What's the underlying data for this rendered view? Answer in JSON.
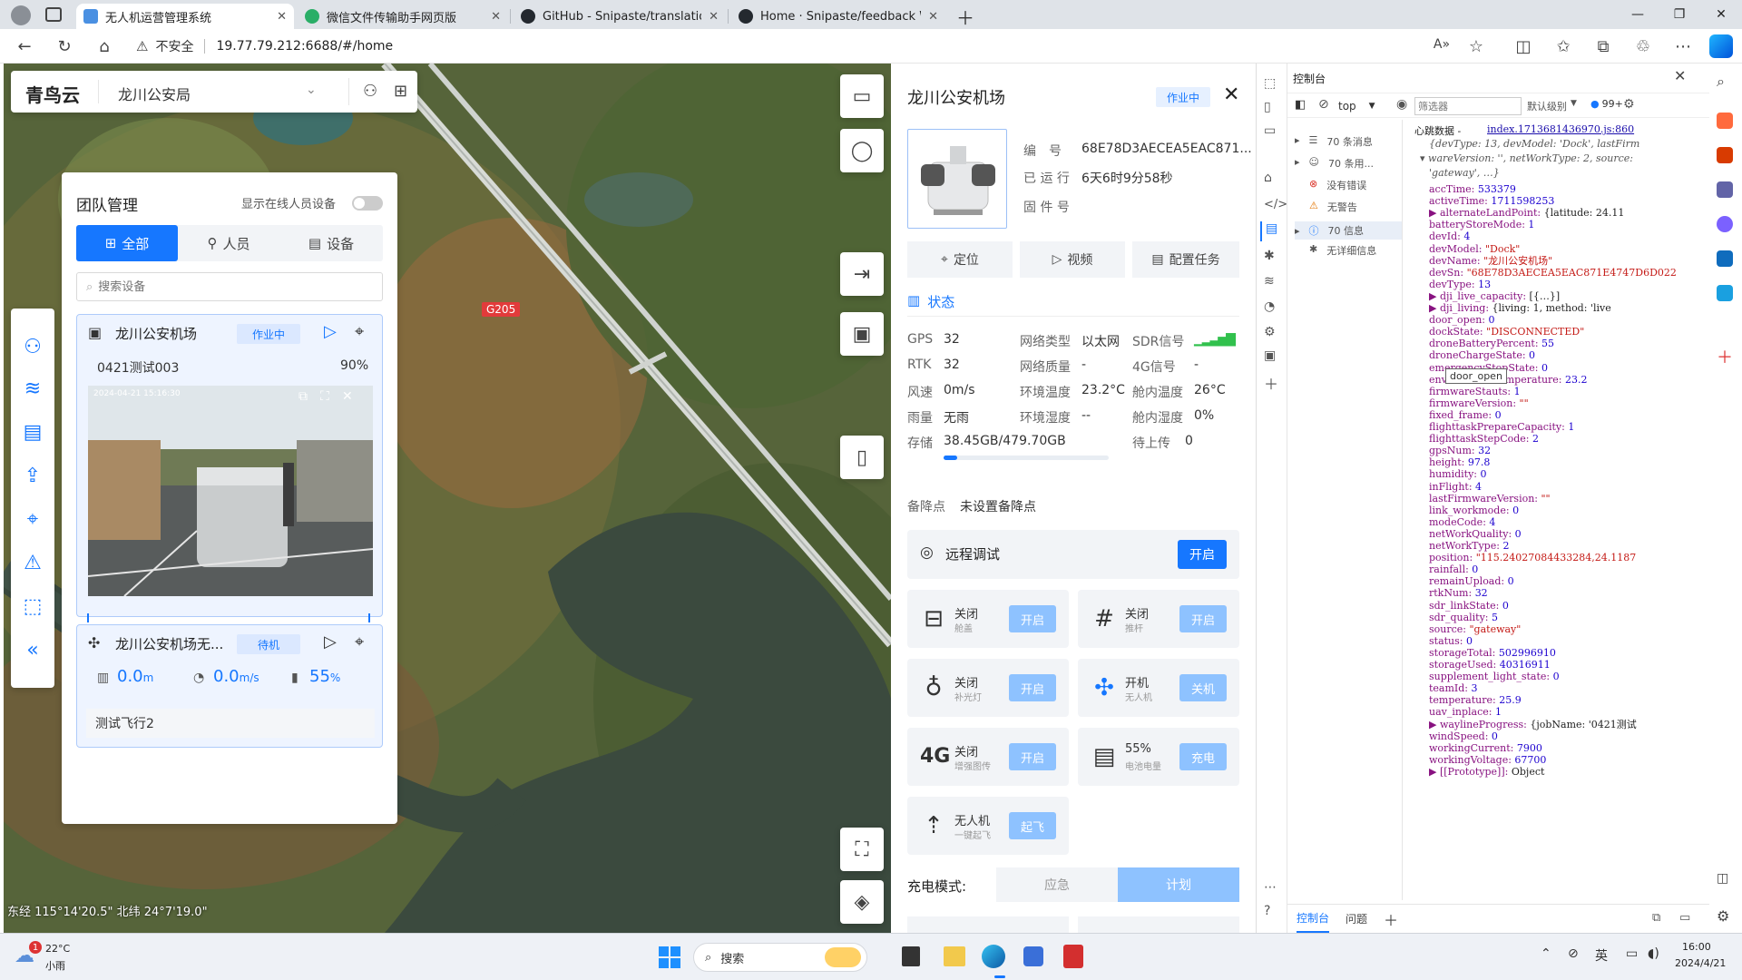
{
  "browser": {
    "tabs": [
      {
        "label": "无人机运营管理系统",
        "active": true
      },
      {
        "label": "微信文件传输助手网页版"
      },
      {
        "label": "GitHub - Snipaste/translations: Tr"
      },
      {
        "label": "Home · Snipaste/feedback Wiki ·"
      }
    ],
    "security": "不安全",
    "url": "19.77.79.212:6688/#/home"
  },
  "app": {
    "logo": "青鸟云",
    "org": "龙川公安局"
  },
  "team": {
    "title": "团队管理",
    "show_online_label": "显示在线人员设备",
    "tabs": [
      "全部",
      "人员",
      "设备"
    ],
    "search_placeholder": "搜索设备",
    "dock_card": {
      "name": "龙川公安机场",
      "status": "作业中",
      "task": "0421测试003",
      "progress": "90%",
      "video_timestamp": "2024-04-21 15:16:30"
    },
    "drone_card": {
      "name": "龙川公安机场无...",
      "status": "待机",
      "height_value": "0.0",
      "height_unit": "m",
      "speed_value": "0.0",
      "speed_unit": "m/s",
      "battery_value": "55",
      "battery_unit": "%",
      "task": "测试飞行2"
    }
  },
  "map": {
    "road_label": "G205",
    "coords": "东经 115°14'20.5\" 北纬 24°7'19.0\""
  },
  "detail": {
    "title": "龙川公安机场",
    "status": "作业中",
    "id_label": "编　号",
    "id_value": "68E78D3AECEA5EAC871...",
    "run_label": "已 运 行",
    "run_value": "6天6时9分58秒",
    "fw_label": "固 件 号",
    "actions": [
      "定位",
      "视频",
      "配置任务"
    ],
    "state_title": "状态",
    "stats": [
      {
        "label": "GPS",
        "value": "32"
      },
      {
        "label": "网络类型",
        "value": "以太网"
      },
      {
        "label": "SDR信号",
        "value": ""
      },
      {
        "label": "RTK",
        "value": "32"
      },
      {
        "label": "网络质量",
        "value": "-"
      },
      {
        "label": "4G信号",
        "value": "-"
      },
      {
        "label": "风速",
        "value": "0m/s"
      },
      {
        "label": "环境温度",
        "value": "23.2°C"
      },
      {
        "label": "舱内温度",
        "value": "26°C"
      },
      {
        "label": "雨量",
        "value": "无雨"
      },
      {
        "label": "环境湿度",
        "value": "--"
      },
      {
        "label": "舱内湿度",
        "value": "0%"
      }
    ],
    "storage_label": "存储",
    "storage_value": "38.45GB/479.70GB",
    "storage_fraction": 0.08,
    "upload_label": "待上传",
    "upload_value": "0",
    "backup_label": "备降点",
    "backup_value": "未设置备降点",
    "remote_debug": "远程调试",
    "remote_debug_btn": "开启",
    "controls": [
      {
        "t1": "关闭",
        "t2": "舱盖",
        "btn": "开启",
        "icon": "hatch-icon"
      },
      {
        "t1": "关闭",
        "t2": "推杆",
        "btn": "开启",
        "icon": "pushrod-icon"
      },
      {
        "t1": "关闭",
        "t2": "补光灯",
        "btn": "开启",
        "icon": "lightbulb-icon"
      },
      {
        "t1": "开机",
        "t2": "无人机",
        "btn": "关机",
        "icon": "drone-icon"
      },
      {
        "t1": "关闭",
        "t2": "增强图传",
        "btn": "开启",
        "icon": "4g-icon"
      },
      {
        "t1": "55%",
        "t2": "电池电量",
        "btn": "充电",
        "icon": "battery-icon"
      },
      {
        "t1": "无人机",
        "t2": "一键起飞",
        "btn": "起飞",
        "icon": "takeoff-icon"
      }
    ],
    "charge_label": "充电模式:",
    "charge_modes": [
      "应急",
      "计划"
    ]
  },
  "devtools": {
    "title": "控制台",
    "context": "top",
    "filter_placeholder": "筛选器",
    "level": "默认级别",
    "issues": "99+",
    "sidebar": [
      {
        "label": "70 条消息"
      },
      {
        "label": "70 条用..."
      },
      {
        "label": "没有错误"
      },
      {
        "label": "无警告"
      },
      {
        "label": "70 信息"
      },
      {
        "label": "无详细信息"
      }
    ],
    "log_title": "心跳数据 -",
    "log_link": "index.1713681436970.js:860",
    "summary1": "{devType: 13, devModel: 'Dock', lastFirm",
    "summary2": "wareVersion: '', netWorkType: 2, source:",
    "summary3": "'gateway', …}",
    "tooltip": "door_open",
    "lines": [
      {
        "k": "accTime",
        "v": "533379",
        "c": "n"
      },
      {
        "k": "activeTime",
        "v": "1711598253",
        "c": "n"
      },
      {
        "k": "▶ alternateLandPoint",
        "v": "{latitude: 24.11",
        "c": "p"
      },
      {
        "k": "batteryStoreMode",
        "v": "1",
        "c": "n"
      },
      {
        "k": "devId",
        "v": "4",
        "c": "n"
      },
      {
        "k": "devModel",
        "v": "\"Dock\"",
        "c": "s"
      },
      {
        "k": "devName",
        "v": "\"龙川公安机场\"",
        "c": "s"
      },
      {
        "k": "devSn",
        "v": "\"68E78D3AECEA5EAC871E4747D6D022",
        "c": "s"
      },
      {
        "k": "devType",
        "v": "13",
        "c": "n"
      },
      {
        "k": "▶ dji_live_capacity",
        "v": "[{…}]",
        "c": "p"
      },
      {
        "k": "▶ dji_living",
        "v": "{living: 1, method: 'live",
        "c": "p"
      },
      {
        "k": "door_open",
        "v": "0",
        "c": "n"
      },
      {
        "k": "dockState",
        "v": "\"DISCONNECTED\"",
        "c": "s"
      },
      {
        "k": "droneBatteryPercent",
        "v": "55",
        "c": "n"
      },
      {
        "k": "droneChargeState",
        "v": "0",
        "c": "n"
      },
      {
        "k": "emergencyStopState",
        "v": "0",
        "c": "n"
      },
      {
        "k": "environmentTemperature",
        "v": "23.2",
        "c": "n"
      },
      {
        "k": "firmwareStauts",
        "v": "1",
        "c": "n"
      },
      {
        "k": "firmwareVersion",
        "v": "\"\"",
        "c": "s"
      },
      {
        "k": "fixed_frame",
        "v": "0",
        "c": "n"
      },
      {
        "k": "flighttaskPrepareCapacity",
        "v": "1",
        "c": "n"
      },
      {
        "k": "flighttaskStepCode",
        "v": "2",
        "c": "n"
      },
      {
        "k": "gpsNum",
        "v": "32",
        "c": "n"
      },
      {
        "k": "height",
        "v": "97.8",
        "c": "n"
      },
      {
        "k": "humidity",
        "v": "0",
        "c": "n"
      },
      {
        "k": "inFlight",
        "v": "4",
        "c": "n"
      },
      {
        "k": "lastFirmwareVersion",
        "v": "\"\"",
        "c": "s"
      },
      {
        "k": "link_workmode",
        "v": "0",
        "c": "n"
      },
      {
        "k": "modeCode",
        "v": "4",
        "c": "n"
      },
      {
        "k": "netWorkQuality",
        "v": "0",
        "c": "n"
      },
      {
        "k": "netWorkType",
        "v": "2",
        "c": "n"
      },
      {
        "k": "position",
        "v": "\"115.24027084433284,24.1187",
        "c": "s"
      },
      {
        "k": "rainfall",
        "v": "0",
        "c": "n"
      },
      {
        "k": "remainUpload",
        "v": "0",
        "c": "n"
      },
      {
        "k": "rtkNum",
        "v": "32",
        "c": "n"
      },
      {
        "k": "sdr_linkState",
        "v": "0",
        "c": "n"
      },
      {
        "k": "sdr_quality",
        "v": "5",
        "c": "n"
      },
      {
        "k": "source",
        "v": "\"gateway\"",
        "c": "s"
      },
      {
        "k": "status",
        "v": "0",
        "c": "n"
      },
      {
        "k": "storageTotal",
        "v": "502996910",
        "c": "n"
      },
      {
        "k": "storageUsed",
        "v": "40316911",
        "c": "n"
      },
      {
        "k": "supplement_light_state",
        "v": "0",
        "c": "n"
      },
      {
        "k": "teamId",
        "v": "3",
        "c": "n"
      },
      {
        "k": "temperature",
        "v": "25.9",
        "c": "n"
      },
      {
        "k": "uav_inplace",
        "v": "1",
        "c": "n"
      },
      {
        "k": "▶ waylineProgress",
        "v": "{jobName: '0421测试",
        "c": "p"
      },
      {
        "k": "windSpeed",
        "v": "0",
        "c": "n"
      },
      {
        "k": "workingCurrent",
        "v": "7900",
        "c": "n"
      },
      {
        "k": "workingVoltage",
        "v": "67700",
        "c": "n"
      },
      {
        "k": "▶ [[Prototype]]",
        "v": "Object",
        "c": "p"
      }
    ],
    "bottom_tabs": [
      "控制台",
      "问题"
    ]
  },
  "taskbar": {
    "temp": "22°C",
    "weather": "小雨",
    "search": "搜索",
    "ime": "英",
    "time": "16:00",
    "date": "2024/4/21",
    "badge": "1"
  },
  "colors": {
    "accent": "#1677ff",
    "accent_light": "#8ec2ff",
    "status_bg": "#e6f0ff"
  }
}
